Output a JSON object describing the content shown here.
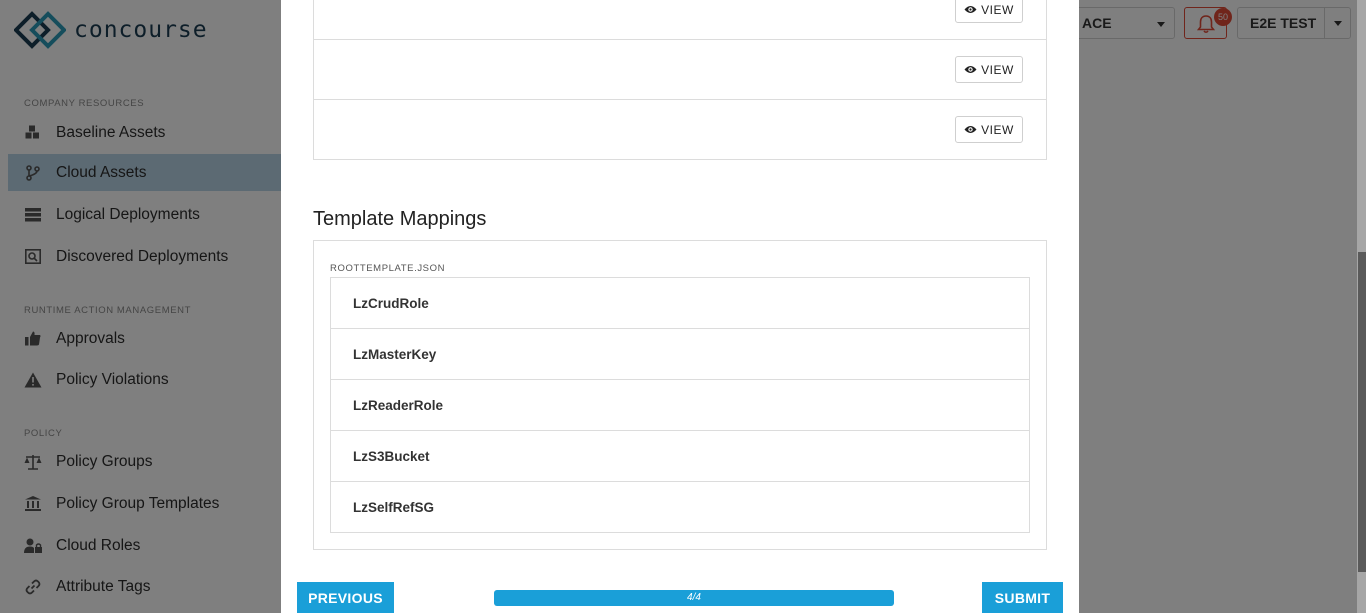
{
  "app": {
    "brand": "concourse",
    "header": {
      "workspace_label": "ACE",
      "notification_count": "50",
      "user_label": "E2E TEST"
    },
    "sidebar": {
      "sections": [
        {
          "label": "COMPANY RESOURCES",
          "items": [
            {
              "label": "Baseline Assets",
              "icon": "cubes-icon"
            },
            {
              "label": "Cloud Assets",
              "icon": "branch-icon",
              "active": true
            },
            {
              "label": "Logical Deployments",
              "icon": "server-stack-icon"
            },
            {
              "label": "Discovered Deployments",
              "icon": "discover-icon"
            }
          ]
        },
        {
          "label": "RUNTIME ACTION MANAGEMENT",
          "items": [
            {
              "label": "Approvals",
              "icon": "thumbs-up-icon"
            },
            {
              "label": "Policy Violations",
              "icon": "warning-icon"
            }
          ]
        },
        {
          "label": "POLICY",
          "items": [
            {
              "label": "Policy Groups",
              "icon": "balance-scale-icon"
            },
            {
              "label": "Policy Group Templates",
              "icon": "institution-icon"
            },
            {
              "label": "Cloud Roles",
              "icon": "user-lock-icon"
            },
            {
              "label": "Attribute Tags",
              "icon": "link-icon"
            }
          ]
        }
      ]
    }
  },
  "modal": {
    "rows": [
      {
        "view_label": "VIEW"
      },
      {
        "view_label": "VIEW"
      },
      {
        "view_label": "VIEW"
      }
    ],
    "template_mappings": {
      "title": "Template Mappings",
      "file_name": "ROOTTEMPLATE.JSON",
      "items": [
        "LzCrudRole",
        "LzMasterKey",
        "LzReaderRole",
        "LzS3Bucket",
        "LzSelfRefSG"
      ]
    },
    "footer": {
      "previous_label": "PREVIOUS",
      "submit_label": "SUBMIT",
      "progress_text": "4/4",
      "progress_fraction": 1.0
    }
  },
  "colors": {
    "accent": "#1a9fd8",
    "active_nav": "#b8d4e6",
    "alert": "#e04a36",
    "brand_dark": "#1b3c52",
    "brand_teal": "#2a9bb8"
  }
}
